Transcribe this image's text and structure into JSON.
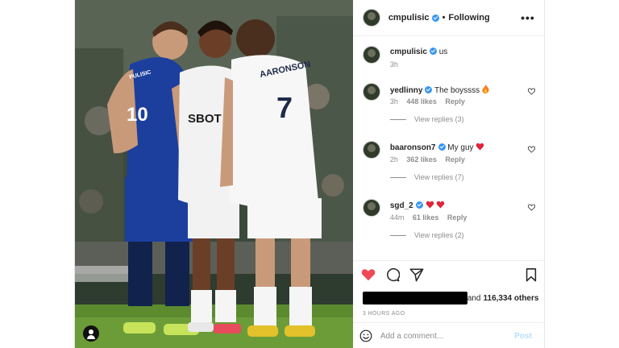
{
  "header": {
    "username": "cmpulisic",
    "separator": "•",
    "follow_status": "Following",
    "more_label": "•••"
  },
  "caption": {
    "username": "cmpulisic",
    "text": "us",
    "time": "3h"
  },
  "comments": [
    {
      "username": "yedlinny",
      "text": "The boyssss",
      "emoji": "fire",
      "time": "3h",
      "likes": "448 likes",
      "reply_label": "Reply",
      "view_replies": "View replies (3)"
    },
    {
      "username": "baaronson7",
      "text": "My guy",
      "emoji": "red-heart",
      "time": "2h",
      "likes": "362 likes",
      "reply_label": "Reply",
      "view_replies": "View replies (7)"
    },
    {
      "username": "sgd_2",
      "text": "",
      "emoji": "two-red-hearts",
      "time": "44m",
      "likes": "61 likes",
      "reply_label": "Reply",
      "view_replies": "View replies (2)"
    }
  ],
  "actions": {
    "liked": true,
    "likes_suffix": "and",
    "likes_count": "116,334 others",
    "posted": "3 HOURS AGO"
  },
  "composer": {
    "placeholder": "Add a comment...",
    "post_label": "Post"
  },
  "photo": {
    "jersey_left_number": "10",
    "jersey_left_name": "PULISIC",
    "jersey_right_number": "7",
    "jersey_right_name": "AARONSON",
    "sponsor": "SBOT"
  },
  "colors": {
    "heart_red": "#ed4956",
    "verified_blue": "#3897f0",
    "post_disabled": "#b2dffc",
    "chelsea_blue": "#1c3f9e"
  }
}
